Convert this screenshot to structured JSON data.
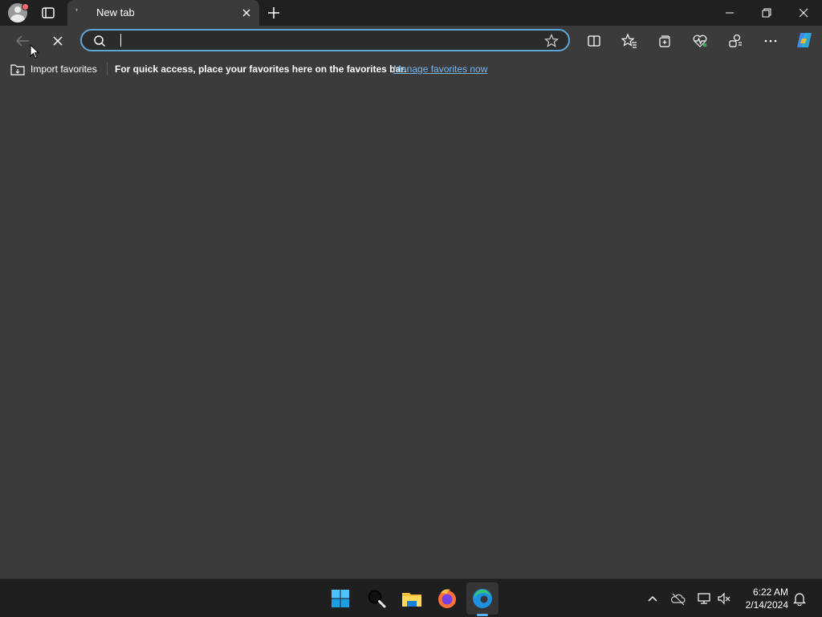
{
  "tab": {
    "title": "New tab"
  },
  "address_bar": {
    "value": "",
    "placeholder": ""
  },
  "favorites_bar": {
    "import_label": "Import favorites",
    "message": "For quick access, place your favorites here on the favorites bar.",
    "link": "Manage favorites now"
  },
  "taskbar": {
    "time": "6:22 AM",
    "date": "2/14/2024"
  },
  "colors": {
    "accent": "#60a5d8",
    "link": "#7ab6ef",
    "background": "#3b3b3b",
    "titlebar": "#202020",
    "taskbar": "#1f1f1f"
  }
}
